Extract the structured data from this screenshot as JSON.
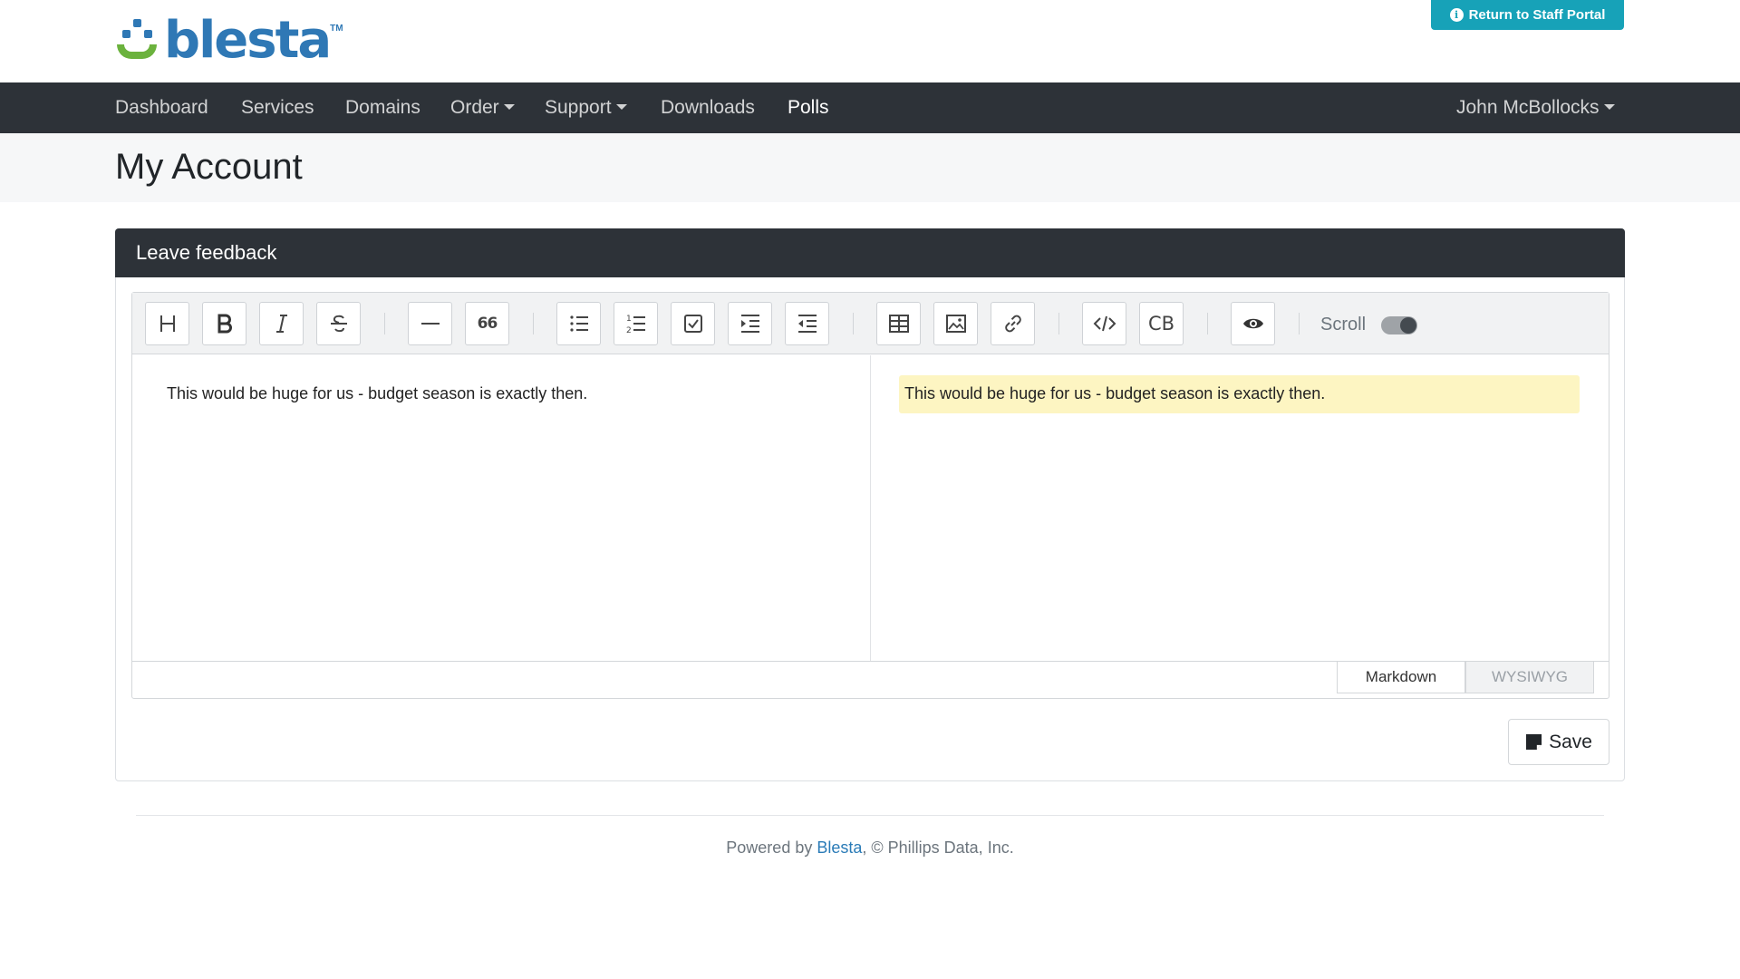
{
  "brand": {
    "logo_text": "blesta",
    "logo_tm": "TM",
    "colors": {
      "blue": "#2f78b5",
      "green": "#6bb23d",
      "nav_bg": "#2d3238",
      "info": "#17a2b8",
      "preview_highlight": "#fdf5c2"
    }
  },
  "header": {
    "staff_portal_label": "Return to Staff Portal",
    "staff_portal_icon": "info-circle-icon"
  },
  "nav": {
    "items": [
      {
        "label": "Dashboard"
      },
      {
        "label": "Services"
      },
      {
        "label": "Domains"
      },
      {
        "label": "Order",
        "dropdown": true
      },
      {
        "label": "Support",
        "dropdown": true
      },
      {
        "label": "Downloads"
      },
      {
        "label": "Polls",
        "active": true
      }
    ],
    "user_label": "John McBollocks"
  },
  "page": {
    "title": "My Account"
  },
  "card": {
    "header": "Leave feedback"
  },
  "editor": {
    "toolbar": [
      {
        "name": "heading-icon",
        "glyph": "H"
      },
      {
        "name": "bold-icon",
        "glyph": "B"
      },
      {
        "name": "italic-icon",
        "glyph": "I"
      },
      {
        "name": "strikethrough-icon",
        "glyph": "S"
      },
      {
        "name": "horizontal-rule-icon",
        "glyph": "—"
      },
      {
        "name": "quote-icon",
        "glyph": "66"
      },
      {
        "name": "bullet-list-icon",
        "glyph": "ul"
      },
      {
        "name": "ordered-list-icon",
        "glyph": "ol"
      },
      {
        "name": "task-list-icon",
        "glyph": "task"
      },
      {
        "name": "indent-icon",
        "glyph": "indent"
      },
      {
        "name": "outdent-icon",
        "glyph": "outdent"
      },
      {
        "name": "table-icon",
        "glyph": "table"
      },
      {
        "name": "image-icon",
        "glyph": "image"
      },
      {
        "name": "link-icon",
        "glyph": "link"
      },
      {
        "name": "code-icon",
        "glyph": "</>"
      },
      {
        "name": "code-block-icon",
        "glyph": "CB"
      },
      {
        "name": "preview-eye-icon",
        "glyph": "eye"
      }
    ],
    "scroll_label": "Scroll",
    "scroll_on": true,
    "markdown_text": "This would be huge for us - budget season is exactly then.",
    "preview_text": "This would be huge for us - budget season is exactly then.",
    "mode_markdown": "Markdown",
    "mode_wysiwyg": "WYSIWYG",
    "cb_label": "CB",
    "quote_label": "66"
  },
  "actions": {
    "save_label": "Save"
  },
  "footer": {
    "prefix": "Powered by ",
    "link": "Blesta",
    "suffix": ", © Phillips Data, Inc."
  }
}
